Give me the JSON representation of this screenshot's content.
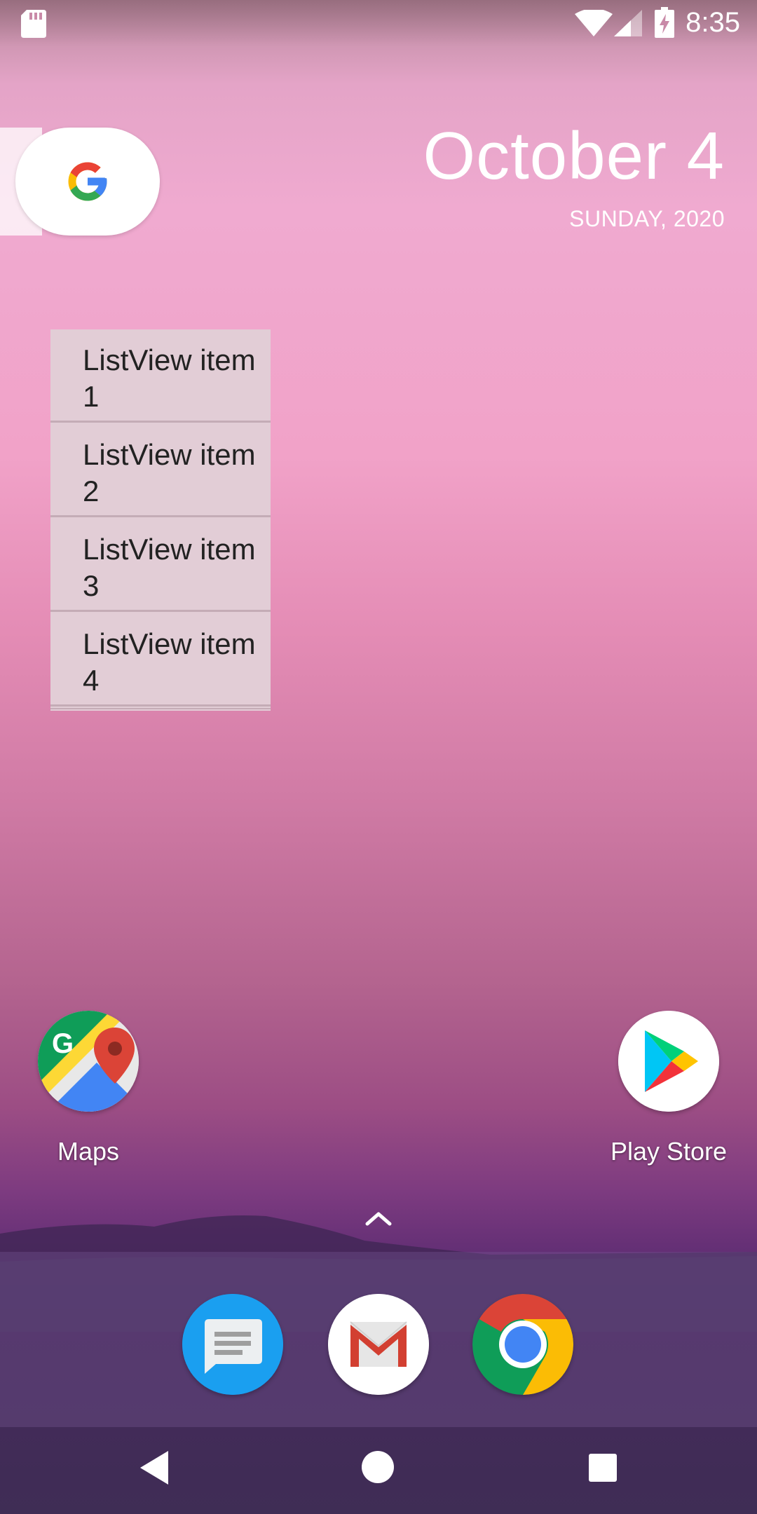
{
  "status_bar": {
    "time": "8:35",
    "icons": [
      "sd-card-icon",
      "wifi-icon",
      "cell-signal-icon",
      "battery-charging-icon"
    ]
  },
  "search_widget": {
    "icon": "google-g-icon"
  },
  "date_widget": {
    "date": "October 4",
    "day_year": "SUNDAY, 2020"
  },
  "list_widget": {
    "items": [
      {
        "label": "ListView item 1"
      },
      {
        "label": "ListView item 2"
      },
      {
        "label": "ListView item 3"
      },
      {
        "label": "ListView item 4"
      }
    ]
  },
  "home_apps": [
    {
      "label": "Maps",
      "icon": "maps-icon"
    },
    {
      "label": "Play Store",
      "icon": "play-store-icon"
    }
  ],
  "app_drawer": {
    "icon": "chevron-up-icon"
  },
  "dock": {
    "apps": [
      {
        "name": "Messages",
        "icon": "messages-icon"
      },
      {
        "name": "Gmail",
        "icon": "gmail-icon"
      },
      {
        "name": "Chrome",
        "icon": "chrome-icon"
      }
    ]
  },
  "nav_bar": {
    "buttons": [
      "back-icon",
      "home-icon",
      "recents-icon"
    ]
  },
  "colors": {
    "list_bg": "#e2cdd6",
    "messages_blue": "#1a9ff0",
    "google_blue": "#4285f4",
    "google_red": "#ea4335",
    "google_yellow": "#fbbc05",
    "google_green": "#34a853"
  }
}
